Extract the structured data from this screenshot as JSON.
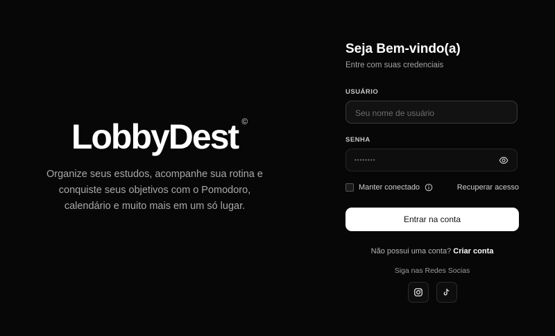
{
  "brand": {
    "name": "LobbyDest",
    "copyright_symbol": "©",
    "tagline": "Organize seus estudos, acompanhe sua rotina e conquiste seus objetivos com o Pomodoro, calendário e muito mais em um só lugar."
  },
  "login": {
    "title": "Seja Bem-vindo(a)",
    "subtitle": "Entre com suas credenciais",
    "username_label": "USUÁRIO",
    "username_placeholder": "Seu nome de usuário",
    "password_label": "SENHA",
    "password_value": "••••••••",
    "remember_label": "Manter conectado",
    "recover_label": "Recuperar acesso",
    "submit_label": "Entrar na conta",
    "signup_prompt": "Não possui uma conta?",
    "signup_link": "Criar conta",
    "social_label": "Siga nas Redes Socias"
  },
  "icons": {
    "eye": "eye-icon",
    "info": "info-icon",
    "instagram": "instagram-icon",
    "tiktok": "tiktok-icon"
  },
  "colors": {
    "background": "#070707",
    "button_bg": "#ffffff",
    "muted_text": "#a9a9a9"
  }
}
